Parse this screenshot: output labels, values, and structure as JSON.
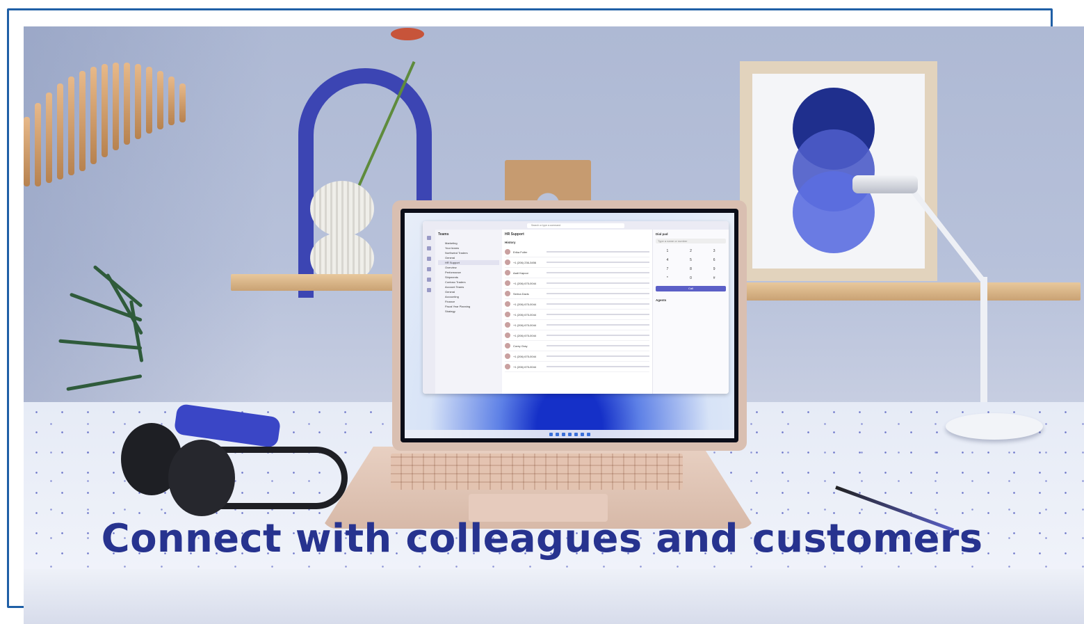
{
  "caption": "Connect with colleagues and customers",
  "screen": {
    "app": "Teams",
    "search_placeholder": "Search or type a command",
    "channel_title": "HR Support",
    "team_items": [
      "Marketing",
      "Your teams",
      "Northwind Traders",
      "General",
      "HR Support",
      "Overview",
      "Performance",
      "Shipments",
      "Contoso Traders",
      "Account Teams",
      "General",
      "Accounting",
      "Finance",
      "Fiscal Year Planning",
      "Strategy"
    ],
    "history_label": "History",
    "history_rows": [
      {
        "name": "Erika Fuller"
      },
      {
        "name": "+1 (206) 236-3456"
      },
      {
        "name": "Aadi Kapoor"
      },
      {
        "name": "+1 (206) 675-0044"
      },
      {
        "name": "Serina Davis"
      },
      {
        "name": "+1 (206) 675-0044"
      },
      {
        "name": "+1 (206) 675-0044"
      },
      {
        "name": "+1 (206) 675-0044"
      },
      {
        "name": "+1 (206) 675-0044"
      },
      {
        "name": "Corey Gray"
      },
      {
        "name": "+1 (206) 675-0044"
      },
      {
        "name": "+1 (206) 675-0044"
      }
    ],
    "dial_pad_label": "Dial pad",
    "dial_input_placeholder": "Type a name or number",
    "keys": [
      "1",
      "2",
      "3",
      "4",
      "5",
      "6",
      "7",
      "8",
      "9",
      "*",
      "0",
      "#"
    ],
    "call_label": "Call",
    "agents_label": "Agents"
  },
  "colors": {
    "frame": "#1f5fa6",
    "caption": "#27338f",
    "teams_accent": "#5b5fc7"
  }
}
